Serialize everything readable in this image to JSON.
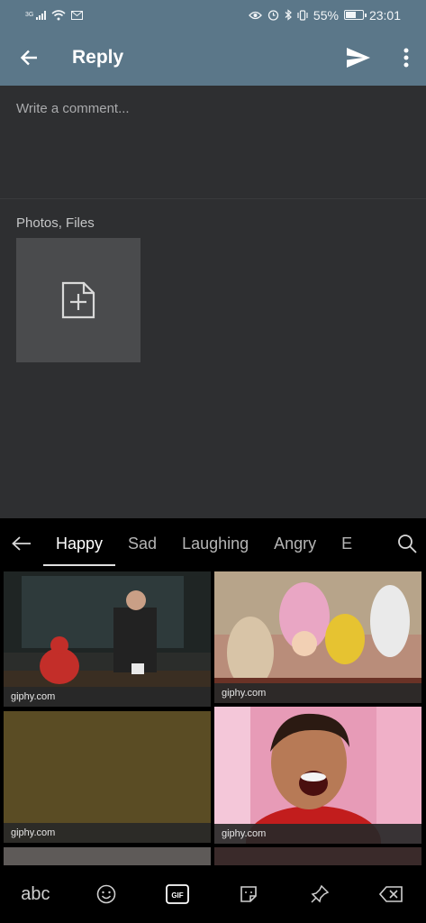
{
  "status_bar": {
    "network": "3G",
    "battery_percent": "55%",
    "battery_level": 0.55,
    "time": "23:01",
    "icons": [
      "signal-icon",
      "wifi-icon",
      "mail-icon",
      "eye-icon",
      "alarm-icon",
      "bluetooth-icon",
      "vibrate-icon",
      "battery-icon"
    ]
  },
  "app_bar": {
    "title": "Reply",
    "icons": {
      "back": "arrow-left-icon",
      "send": "send-icon",
      "more": "more-vert-icon"
    }
  },
  "comment": {
    "placeholder": "Write a comment...",
    "value": ""
  },
  "attachments": {
    "label": "Photos, Files",
    "add_icon": "add-file-icon"
  },
  "gif_keyboard": {
    "tabs": [
      {
        "label": "Happy",
        "active": true
      },
      {
        "label": "Sad",
        "active": false
      },
      {
        "label": "Laughing",
        "active": false
      },
      {
        "label": "Angry",
        "active": false
      },
      {
        "label": "E",
        "active": false
      }
    ],
    "results": [
      {
        "source": "giphy.com",
        "thumb_color": "#2b2d2b"
      },
      {
        "source": "giphy.com",
        "thumb_color": "#b98d7a"
      },
      {
        "source": "giphy.com",
        "thumb_color": "#5a4c24"
      },
      {
        "source": "giphy.com",
        "thumb_color": "#e79bb7"
      }
    ],
    "bottom_bar": {
      "abc_label": "abc",
      "gif_label": "GIF",
      "icons": [
        "emoji-icon",
        "gif-icon",
        "sticker-icon",
        "pin-icon",
        "backspace-icon"
      ]
    }
  }
}
